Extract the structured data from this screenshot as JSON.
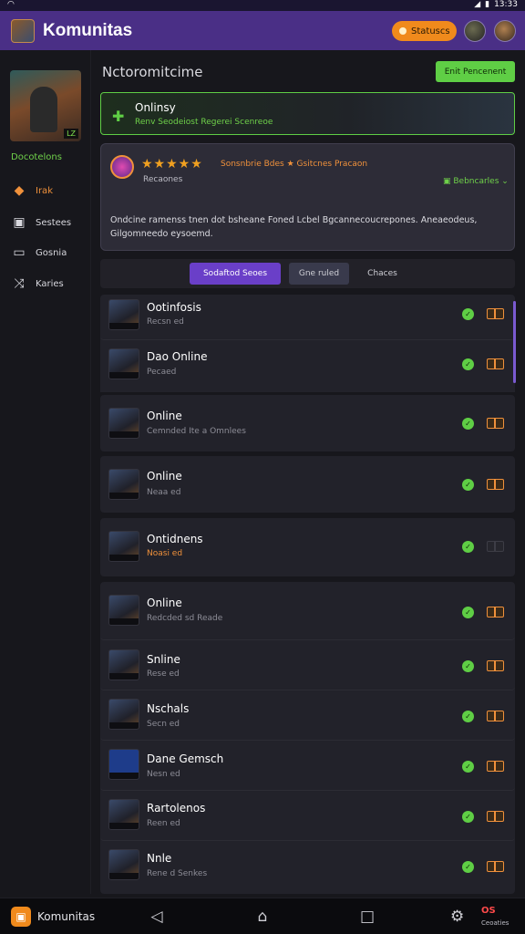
{
  "status_bar": {
    "left_icon": "wifi-icon",
    "time": "13:33"
  },
  "app_bar": {
    "title": "Komunitas",
    "status_pill": "Statuscs"
  },
  "sidebar": {
    "art_badge": "LZ",
    "caption": "Docotelons",
    "items": [
      {
        "label": "Irak",
        "icon": "game-icon",
        "active": true
      },
      {
        "label": "Sestees",
        "icon": "controller-icon",
        "active": false
      },
      {
        "label": "Gosnia",
        "icon": "chat-icon",
        "active": false
      },
      {
        "label": "Karies",
        "icon": "shuffle-icon",
        "active": false
      }
    ]
  },
  "main": {
    "title": "Nctoromitcime",
    "primary_button": "Enit Pencenent",
    "online_card": {
      "title": "Onlinsy",
      "subtitle": "Renv Seodeiost Regerei Scenreoe"
    },
    "review": {
      "stars": 5,
      "rating_text": "Sonsnbrie Bdes ★ Gsitcnes Pracaon",
      "author": "Recaones",
      "translate_label": "Bebncarles",
      "body": "Ondcine ramenss tnen dot bsheane Foned Lcbel Bgcannecoucrepones. Aneaeodeus, Gilgomneedo eysoemd."
    },
    "tabs": [
      "Sodaftod Seoes",
      "Gne ruled",
      "Chaces"
    ],
    "rows": [
      {
        "name": "Ootinfosis",
        "sub": "Recsn ed",
        "accent": false,
        "online": true,
        "toggle": true
      },
      {
        "name": "Dao Online",
        "sub": "Pecaed",
        "accent": false,
        "online": true,
        "toggle": true
      },
      {
        "name": "Online",
        "sub": "Cemnded Ite a Omnlees",
        "accent": false,
        "online": true,
        "toggle": true
      },
      {
        "name": "Online",
        "sub": "Neaa ed",
        "accent": false,
        "online": true,
        "toggle": true
      },
      {
        "name": "Ontidnens",
        "sub": "Noasi ed",
        "accent": true,
        "online": true,
        "toggle": false
      },
      {
        "name": "Online",
        "sub": "Redcded sd Reade",
        "accent": false,
        "online": true,
        "toggle": true
      },
      {
        "name": "Snline",
        "sub": "Rese ed",
        "accent": false,
        "online": true,
        "toggle": true
      },
      {
        "name": "Nschals",
        "sub": "Secn ed",
        "accent": false,
        "online": true,
        "toggle": true
      },
      {
        "name": "Dane Gemsch",
        "sub": "Nesn ed",
        "accent": false,
        "online": true,
        "toggle": true
      },
      {
        "name": "Rartolenos",
        "sub": "Reen ed",
        "accent": false,
        "online": true,
        "toggle": true
      },
      {
        "name": "Nnle",
        "sub": "Rene d Senkes",
        "accent": false,
        "online": true,
        "toggle": true
      }
    ]
  },
  "nav_bar": {
    "app_name": "Komunitas",
    "badge": "OS",
    "badge_label": "Ceoaties"
  }
}
